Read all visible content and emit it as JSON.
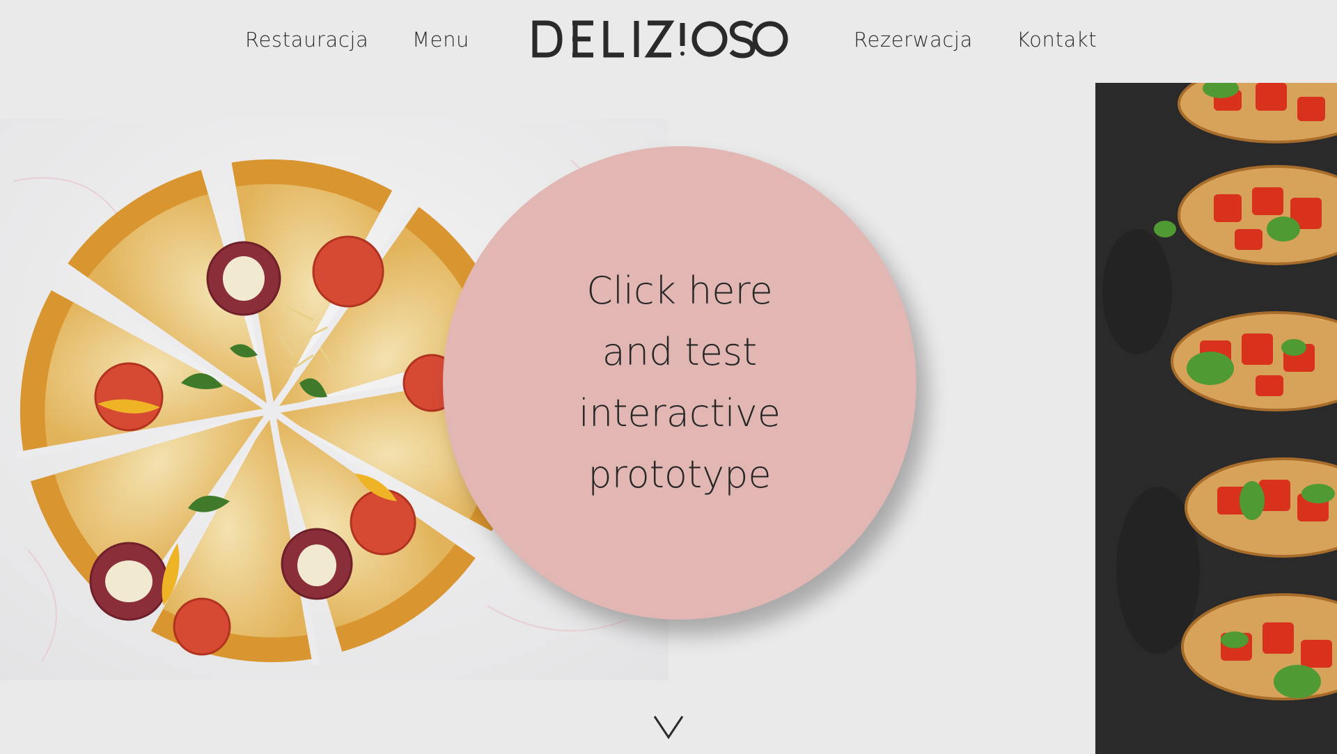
{
  "header": {
    "nav_left": [
      "Restauracja",
      "Menu"
    ],
    "logo_text": "DELIZIOSO",
    "nav_right": [
      "Rezerwacja",
      "Kontakt"
    ]
  },
  "hero": {
    "cta_lines": [
      "Click here",
      "and test",
      "interactive",
      "prototype"
    ]
  },
  "icons": {
    "scroll": "chevron-down-icon"
  },
  "colors": {
    "background": "#eaeaea",
    "circle": "#e1b6b3",
    "text": "#2a2a2a"
  }
}
